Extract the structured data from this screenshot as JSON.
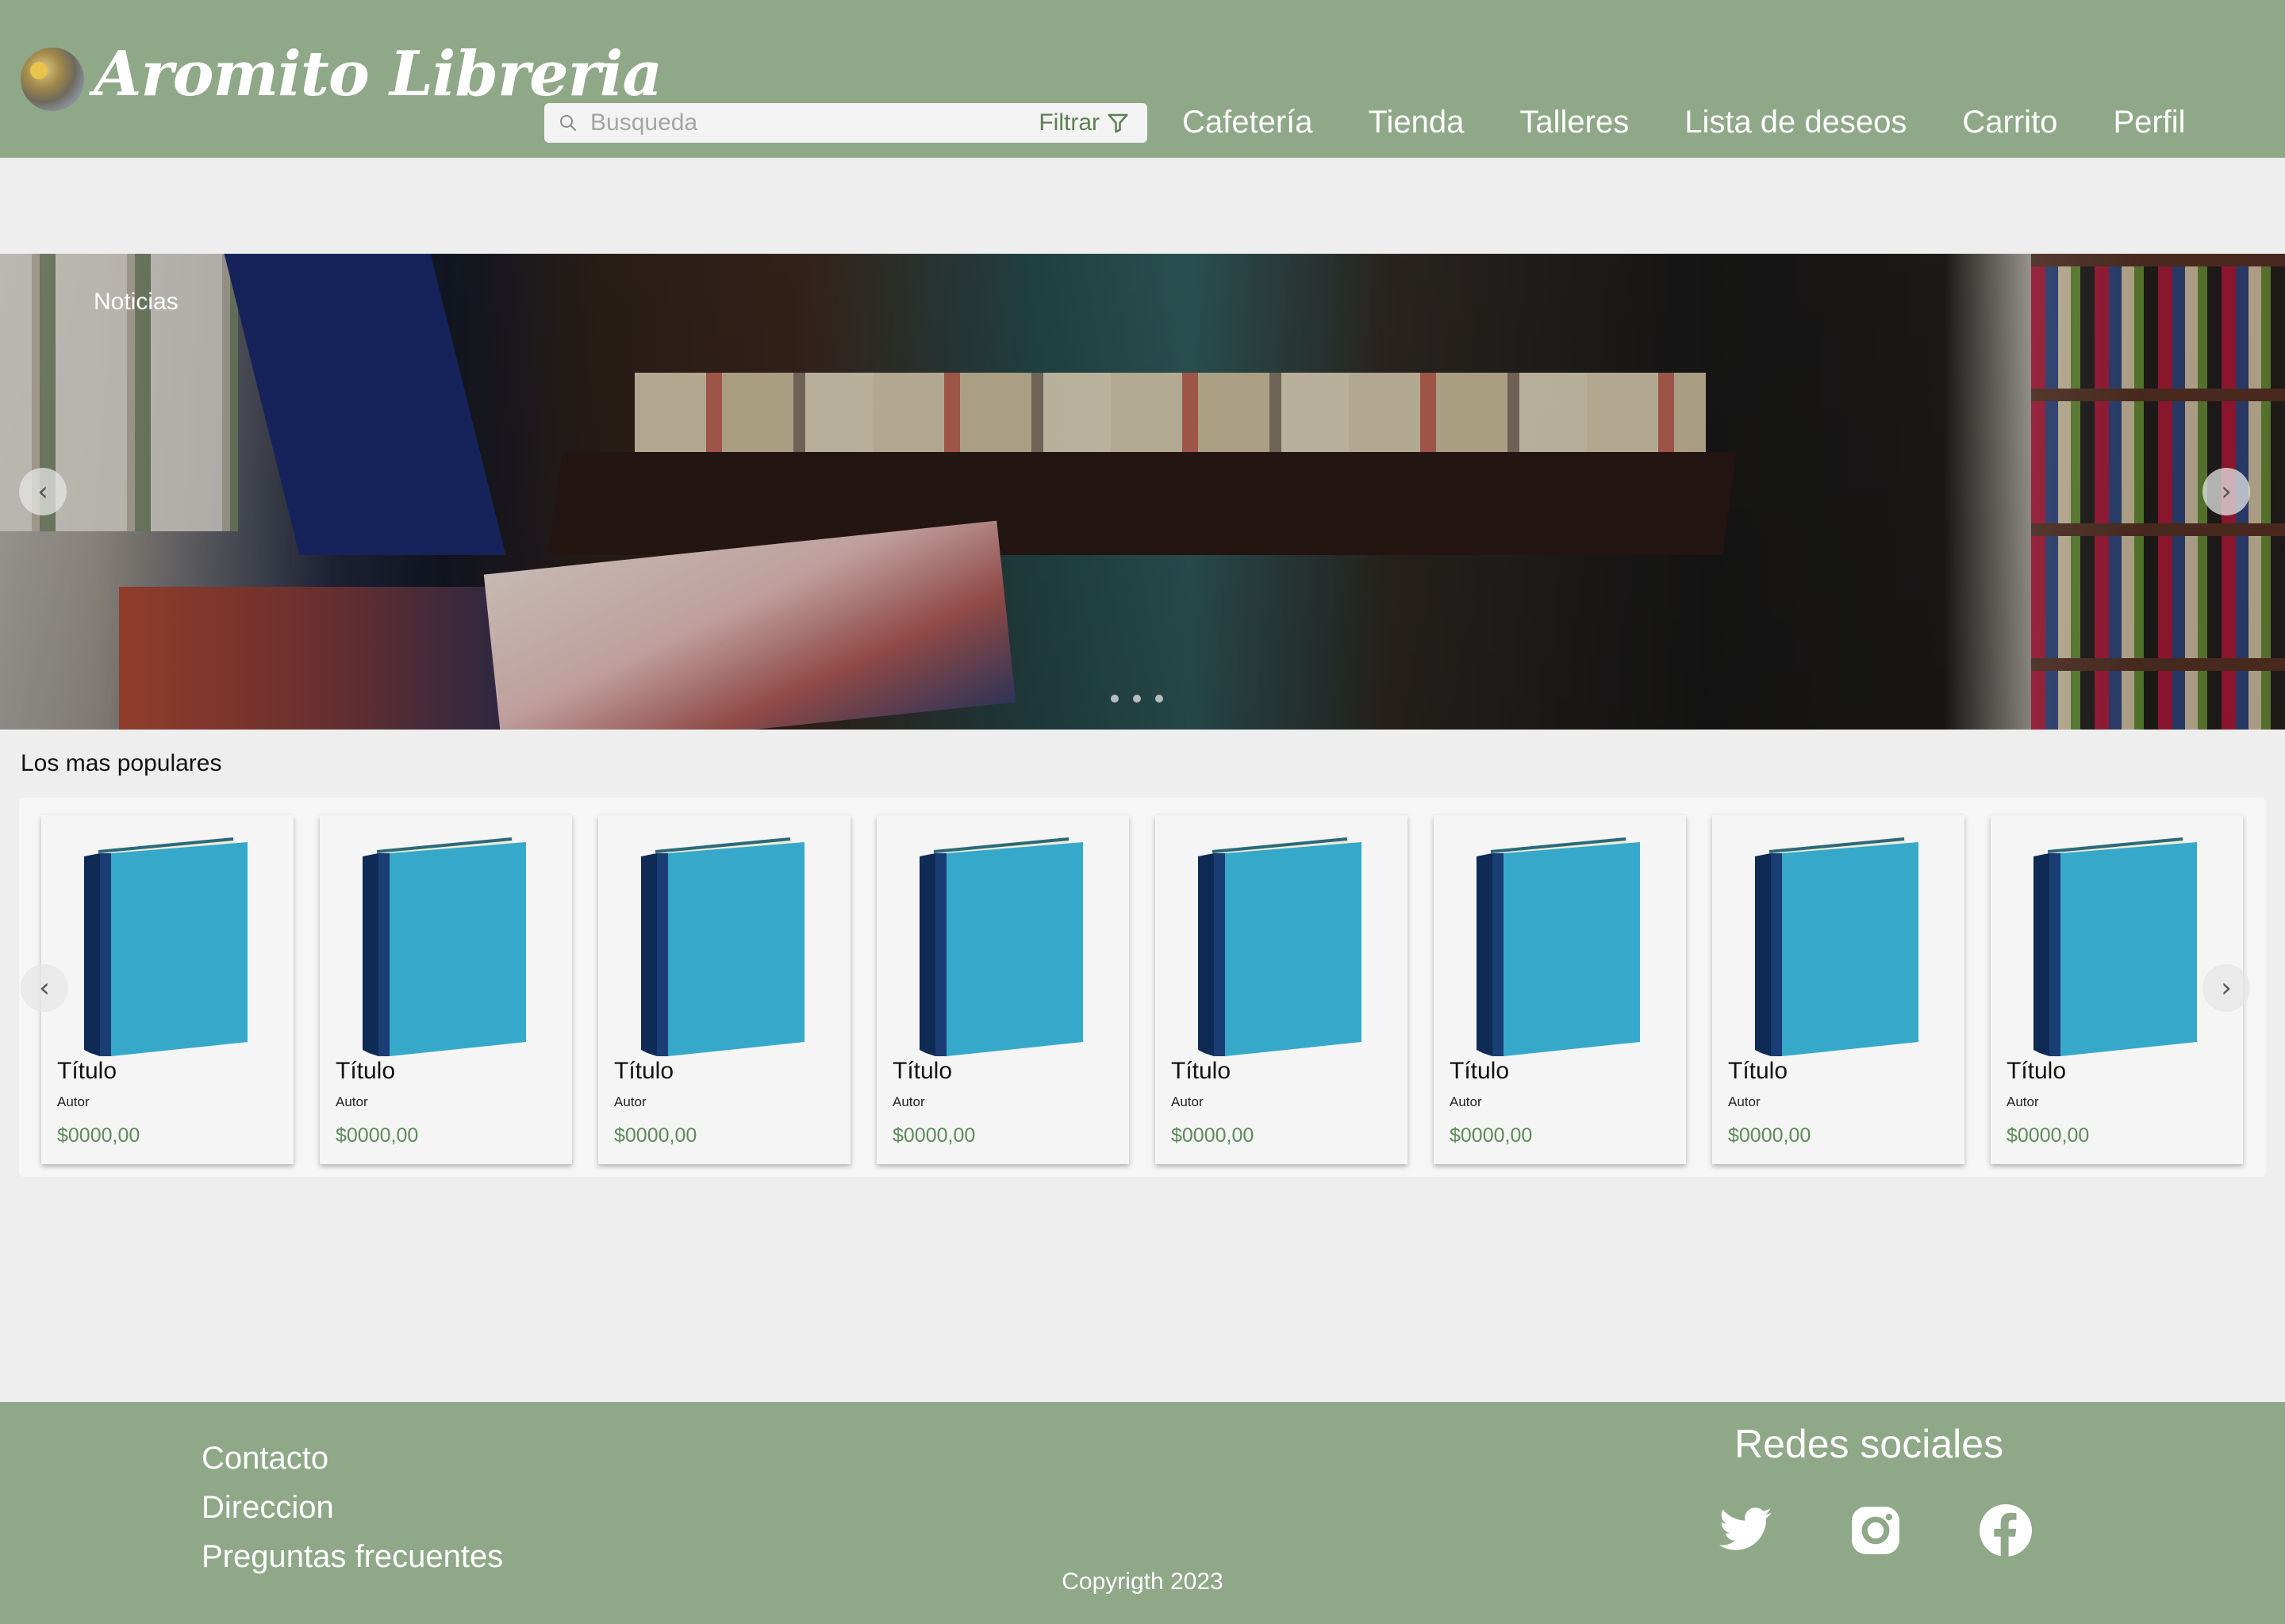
{
  "header": {
    "brand": "Aromito Libreria",
    "logo_icon": "flower-logo-icon",
    "search": {
      "placeholder": "Busqueda",
      "value": "",
      "filter_label": "Filtrar",
      "filter_icon": "filter-funnel-icon"
    },
    "nav": [
      {
        "label": "Cafetería"
      },
      {
        "label": "Tienda"
      },
      {
        "label": "Talleres"
      },
      {
        "label": "Lista de deseos"
      },
      {
        "label": "Carrito"
      },
      {
        "label": "Perfil"
      }
    ]
  },
  "hero": {
    "title": "Noticias",
    "prev_icon": "chevron-left-icon",
    "next_icon": "chevron-right-icon",
    "slides": 3,
    "active_slide": 2
  },
  "popular": {
    "title": "Los mas populares",
    "items": [
      {
        "title": "Título",
        "author": "Autor",
        "price": "$0000,00"
      },
      {
        "title": "Título",
        "author": "Autor",
        "price": "$0000,00"
      },
      {
        "title": "Título",
        "author": "Autor",
        "price": "$0000,00"
      },
      {
        "title": "Título",
        "author": "Autor",
        "price": "$0000,00"
      },
      {
        "title": "Título",
        "author": "Autor",
        "price": "$0000,00"
      },
      {
        "title": "Título",
        "author": "Autor",
        "price": "$0000,00"
      },
      {
        "title": "Título",
        "author": "Autor",
        "price": "$0000,00"
      },
      {
        "title": "Título",
        "author": "Autor",
        "price": "$0000,00"
      }
    ]
  },
  "footer": {
    "links": [
      {
        "label": "Contacto"
      },
      {
        "label": "Direccion"
      },
      {
        "label": "Preguntas frecuentes"
      }
    ],
    "copyright": "Copyrigth 2023",
    "social_title": "Redes sociales",
    "social": [
      "twitter-icon",
      "instagram-icon",
      "facebook-icon"
    ]
  },
  "colors": {
    "header_bg": "#8fa888",
    "page_bg": "#eeeeee",
    "price": "#5d8a58",
    "book_cover": "#36a9cb",
    "book_spine": "#0e2a55"
  }
}
